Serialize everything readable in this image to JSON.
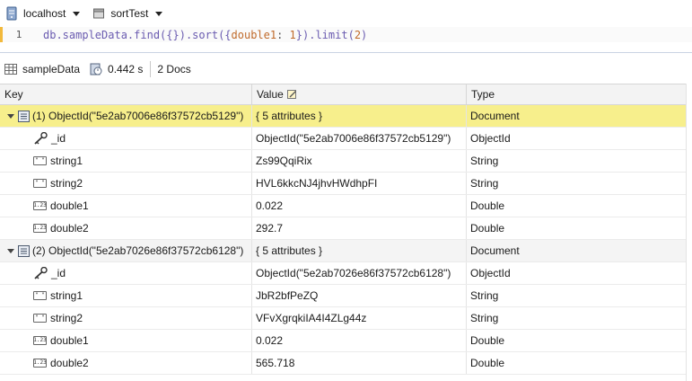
{
  "connection": {
    "host": "localhost",
    "database": "sortTest"
  },
  "editor": {
    "line_number": "1",
    "query_parts": {
      "p1": "db.sampleData.find({}).sort({",
      "field": "double1",
      "p2": ": ",
      "dir": "1",
      "p3": "}).limit(",
      "limit": "2",
      "p4": ")"
    }
  },
  "result_bar": {
    "collection": "sampleData",
    "time": "0.442 s",
    "doc_count": "2 Docs"
  },
  "table": {
    "columns": {
      "key": "Key",
      "value": "Value",
      "type": "Type"
    },
    "documents": [
      {
        "key": "(1) ObjectId(\"5e2ab7006e86f37572cb5129\")",
        "value": "{ 5 attributes }",
        "type": "Document",
        "fields": [
          {
            "icon": "key-icon",
            "key": "_id",
            "value": "ObjectId(\"5e2ab7006e86f37572cb5129\")",
            "type": "ObjectId"
          },
          {
            "icon": "string-icon",
            "key": "string1",
            "value": "Zs99QqiRix",
            "type": "String"
          },
          {
            "icon": "string-icon",
            "key": "string2",
            "value": "HVL6kkcNJ4jhvHWdhpFI",
            "type": "String"
          },
          {
            "icon": "number-icon",
            "key": "double1",
            "value": "0.022",
            "type": "Double"
          },
          {
            "icon": "number-icon",
            "key": "double2",
            "value": "292.7",
            "type": "Double"
          }
        ]
      },
      {
        "key": "(2) ObjectId(\"5e2ab7026e86f37572cb6128\")",
        "value": "{ 5 attributes }",
        "type": "Document",
        "fields": [
          {
            "icon": "key-icon",
            "key": "_id",
            "value": "ObjectId(\"5e2ab7026e86f37572cb6128\")",
            "type": "ObjectId"
          },
          {
            "icon": "string-icon",
            "key": "string1",
            "value": "JbR2bfPeZQ",
            "type": "String"
          },
          {
            "icon": "string-icon",
            "key": "string2",
            "value": "VFvXgrqkiIA4I4ZLg44z",
            "type": "String"
          },
          {
            "icon": "number-icon",
            "key": "double1",
            "value": "0.022",
            "type": "Double"
          },
          {
            "icon": "number-icon",
            "key": "double2",
            "value": "565.718",
            "type": "Double"
          }
        ]
      }
    ]
  },
  "colors": {
    "selected_row": "#f7ef8c",
    "editor_marker": "#f2b93c"
  }
}
